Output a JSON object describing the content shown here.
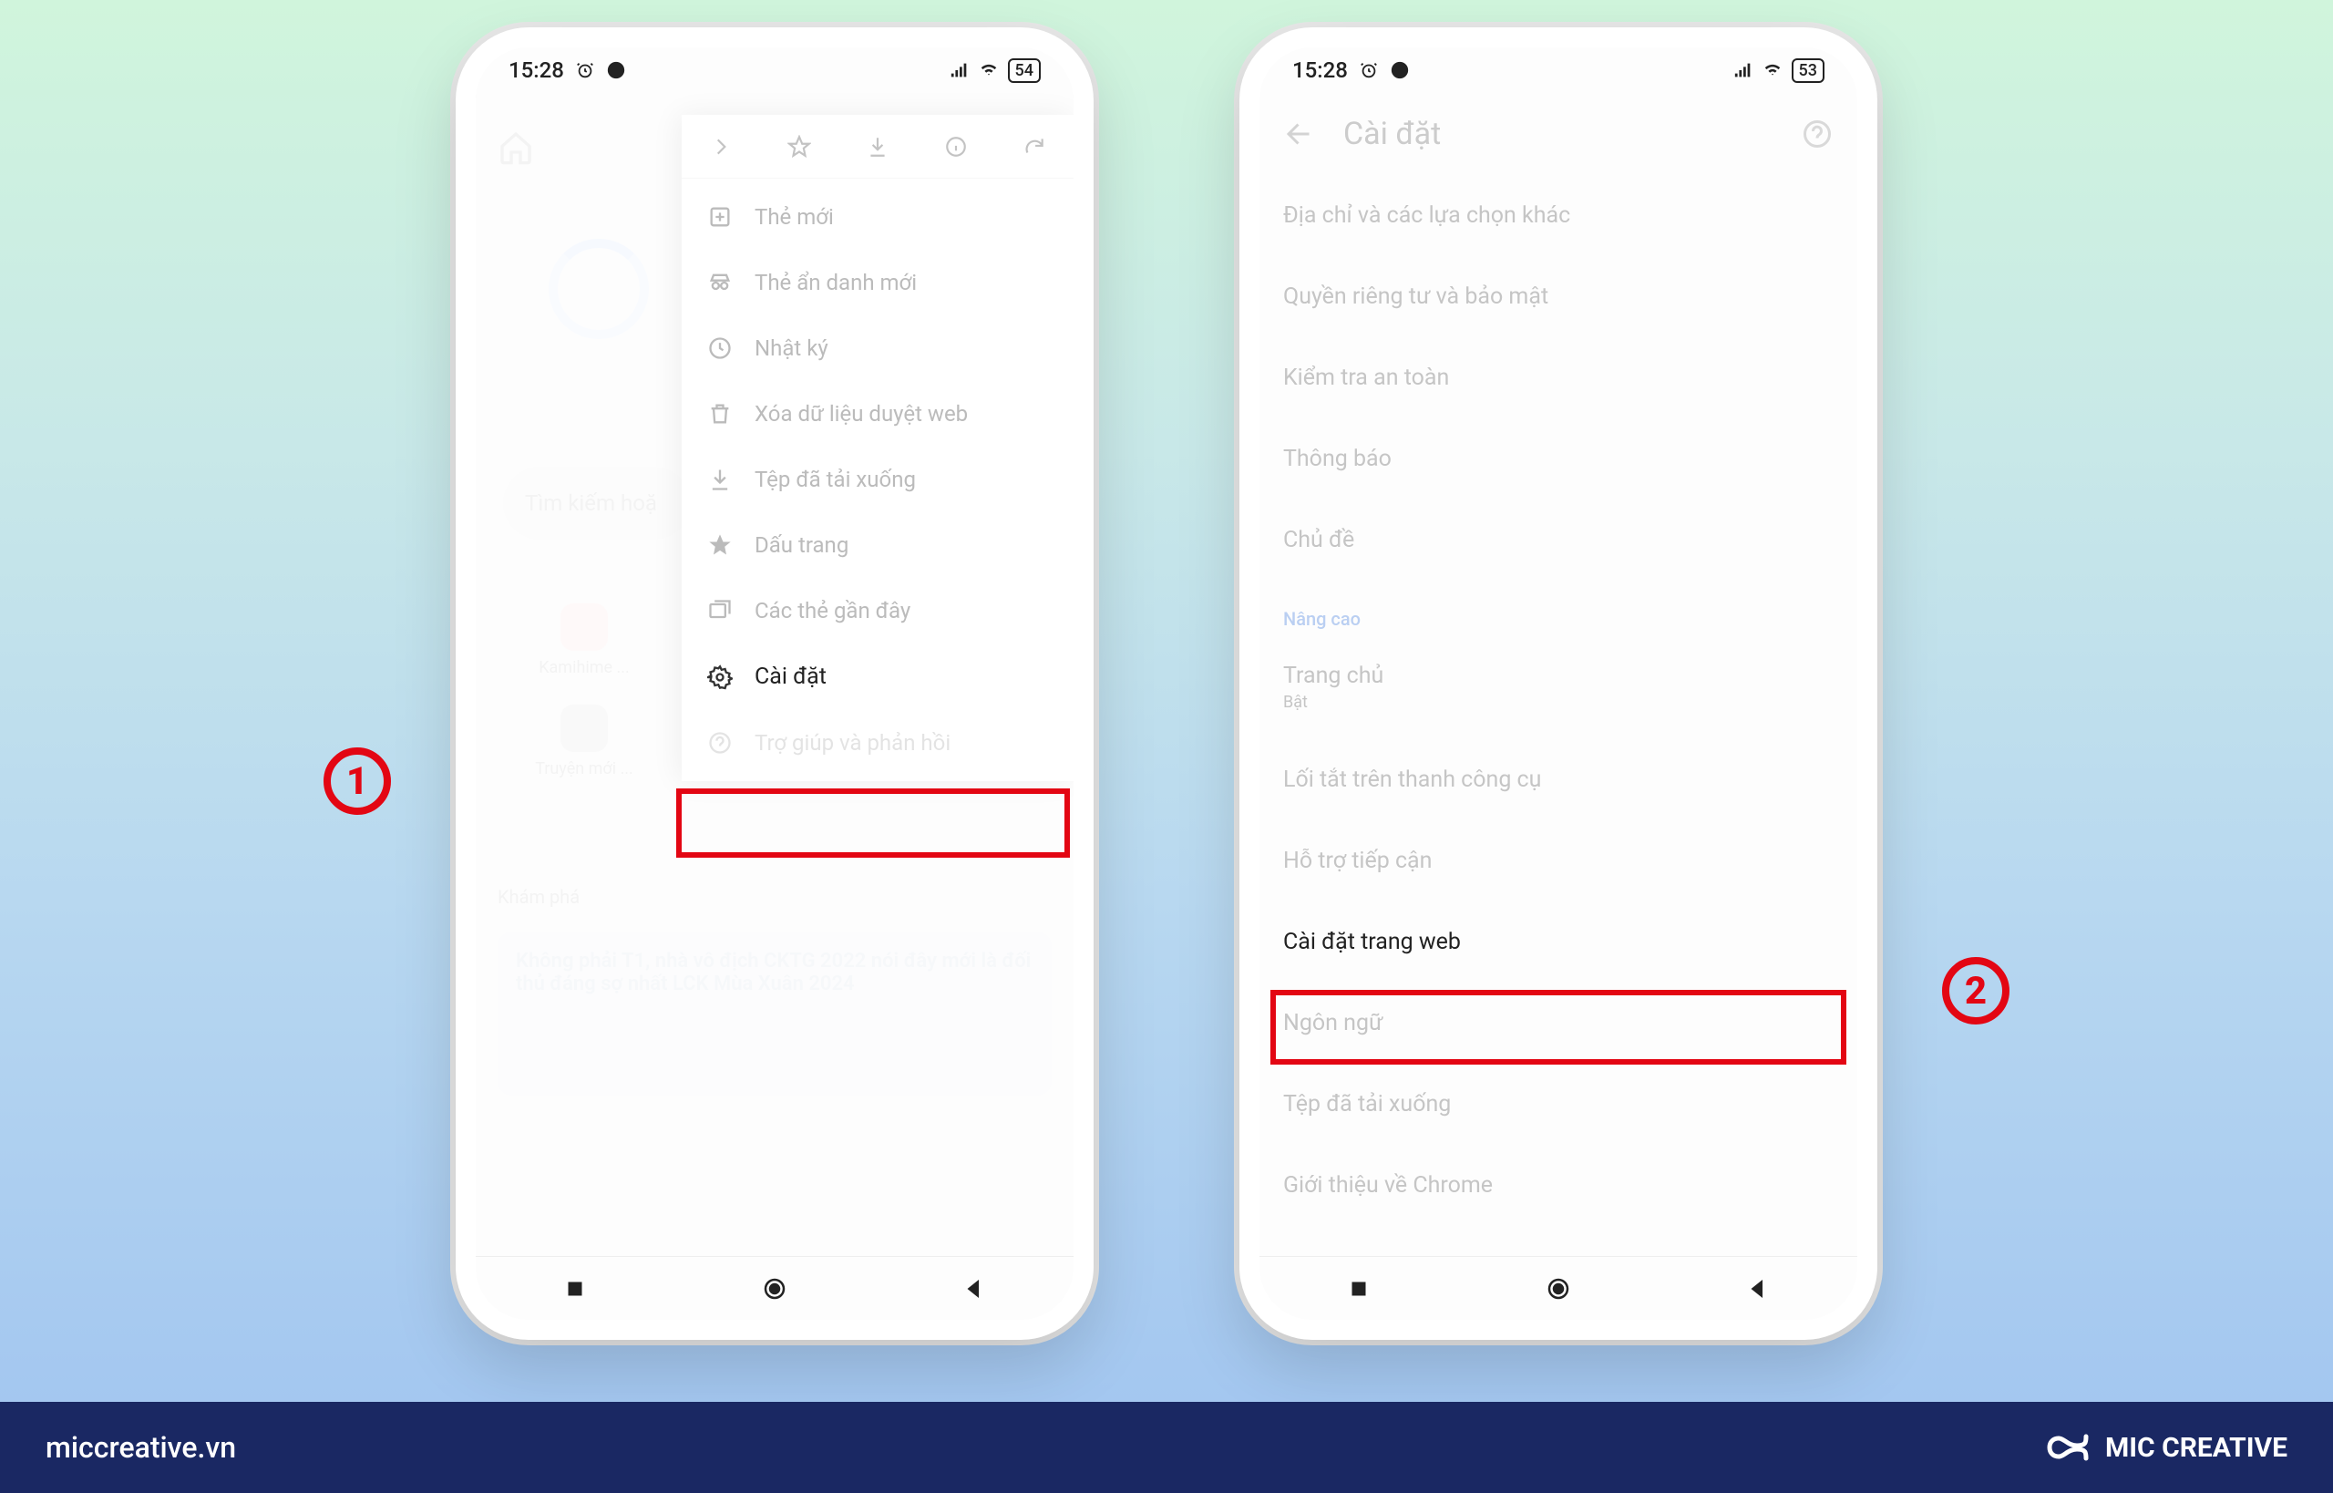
{
  "footer": {
    "site": "miccreative.vn",
    "brand": "MIC CREATIVE"
  },
  "step1": "1",
  "step2": "2",
  "phone1": {
    "status": {
      "time": "15:28",
      "battery": "54"
    },
    "search_ghost": "Tìm kiếm hoặ",
    "site1": "Kamihime ...",
    "site2": "Truyện mới ...",
    "section": "Khám phá",
    "newsGhost": "Không phải T1, nhà vô địch CKTG 2022 nói đây mới là đối thủ đáng sợ nhất LCK Mùa Xuân 2024",
    "menu": {
      "new_tab": "Thẻ mới",
      "incognito": "Thẻ ẩn danh mới",
      "history": "Nhật ký",
      "clear": "Xóa dữ liệu duyệt web",
      "downloads": "Tệp đã tải xuống",
      "bookmarks": "Dấu trang",
      "recent": "Các thẻ gần đây",
      "settings": "Cài đặt",
      "help": "Trợ giúp và phản hồi"
    }
  },
  "phone2": {
    "status": {
      "time": "15:28",
      "battery": "53"
    },
    "header": "Cài đặt",
    "items": {
      "addresses": "Địa chỉ và các lựa chọn khác",
      "privacy": "Quyền riêng tư và bảo mật",
      "safety": "Kiểm tra an toàn",
      "notifications": "Thông báo",
      "theme": "Chủ đề",
      "advanced": "Nâng cao",
      "homepage": "Trang chủ",
      "homepage_sub": "Bật",
      "toolbar": "Lối tắt trên thanh công cụ",
      "accessibility": "Hỗ trợ tiếp cận",
      "site_settings": "Cài đặt trang web",
      "language": "Ngôn ngữ",
      "downloads": "Tệp đã tải xuống",
      "about": "Giới thiệu về Chrome"
    }
  }
}
